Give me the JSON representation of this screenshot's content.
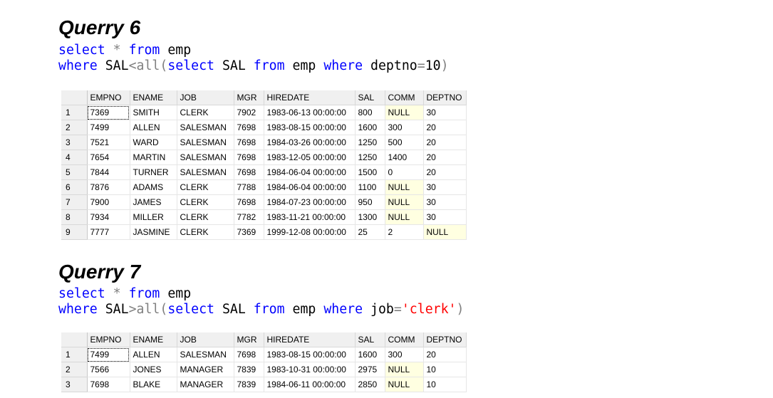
{
  "q6": {
    "title": "Querry 6",
    "line1": {
      "kw1": "select",
      "star": " * ",
      "kw2": "from",
      "rest": " emp"
    },
    "line2": {
      "kw1": "where",
      "a": " SAL",
      "op": "<all(",
      "kw2": "select",
      "b": " SAL ",
      "kw3": "from",
      "c": " emp ",
      "kw4": "where",
      "d": " deptno",
      "eq": "=",
      "e": "10",
      "close": ")"
    }
  },
  "q7": {
    "title": "Querry 7",
    "line1": {
      "kw1": "select",
      "star": " * ",
      "kw2": "from",
      "rest": " emp"
    },
    "line2": {
      "kw1": "where",
      "a": " SAL",
      "op": ">all(",
      "kw2": "select",
      "b": " SAL ",
      "kw3": "from",
      "c": " emp ",
      "kw4": "where",
      "d": " job",
      "eq": "=",
      "str": "'clerk'",
      "close": ")"
    }
  },
  "grid1": {
    "columns": [
      "EMPNO",
      "ENAME",
      "JOB",
      "MGR",
      "HIREDATE",
      "SAL",
      "COMM",
      "DEPTNO"
    ],
    "rows": [
      [
        "1",
        "7369",
        "SMITH",
        "CLERK",
        "7902",
        "1983-06-13 00:00:00",
        "800",
        "NULL",
        "30"
      ],
      [
        "2",
        "7499",
        "ALLEN",
        "SALESMAN",
        "7698",
        "1983-08-15 00:00:00",
        "1600",
        "300",
        "20"
      ],
      [
        "3",
        "7521",
        "WARD",
        "SALESMAN",
        "7698",
        "1984-03-26 00:00:00",
        "1250",
        "500",
        "20"
      ],
      [
        "4",
        "7654",
        "MARTIN",
        "SALESMAN",
        "7698",
        "1983-12-05 00:00:00",
        "1250",
        "1400",
        "20"
      ],
      [
        "5",
        "7844",
        "TURNER",
        "SALESMAN",
        "7698",
        "1984-06-04 00:00:00",
        "1500",
        "0",
        "20"
      ],
      [
        "6",
        "7876",
        "ADAMS",
        "CLERK",
        "7788",
        "1984-06-04 00:00:00",
        "1100",
        "NULL",
        "30"
      ],
      [
        "7",
        "7900",
        "JAMES",
        "CLERK",
        "7698",
        "1984-07-23 00:00:00",
        "950",
        "NULL",
        "30"
      ],
      [
        "8",
        "7934",
        "MILLER",
        "CLERK",
        "7782",
        "1983-11-21 00:00:00",
        "1300",
        "NULL",
        "30"
      ],
      [
        "9",
        "7777",
        "JASMINE",
        "CLERK",
        "7369",
        "1999-12-08 00:00:00",
        "25",
        "2",
        "NULL"
      ]
    ]
  },
  "grid2": {
    "columns": [
      "EMPNO",
      "ENAME",
      "JOB",
      "MGR",
      "HIREDATE",
      "SAL",
      "COMM",
      "DEPTNO"
    ],
    "rows": [
      [
        "1",
        "7499",
        "ALLEN",
        "SALESMAN",
        "7698",
        "1983-08-15 00:00:00",
        "1600",
        "300",
        "20"
      ],
      [
        "2",
        "7566",
        "JONES",
        "MANAGER",
        "7839",
        "1983-10-31 00:00:00",
        "2975",
        "NULL",
        "10"
      ],
      [
        "3",
        "7698",
        "BLAKE",
        "MANAGER",
        "7839",
        "1984-06-11 00:00:00",
        "2850",
        "NULL",
        "10"
      ]
    ]
  },
  "colors": {
    "keyword": "#0000ff",
    "operator": "#808080",
    "string": "#ff0000",
    "null_cell": "#ffffe1"
  }
}
